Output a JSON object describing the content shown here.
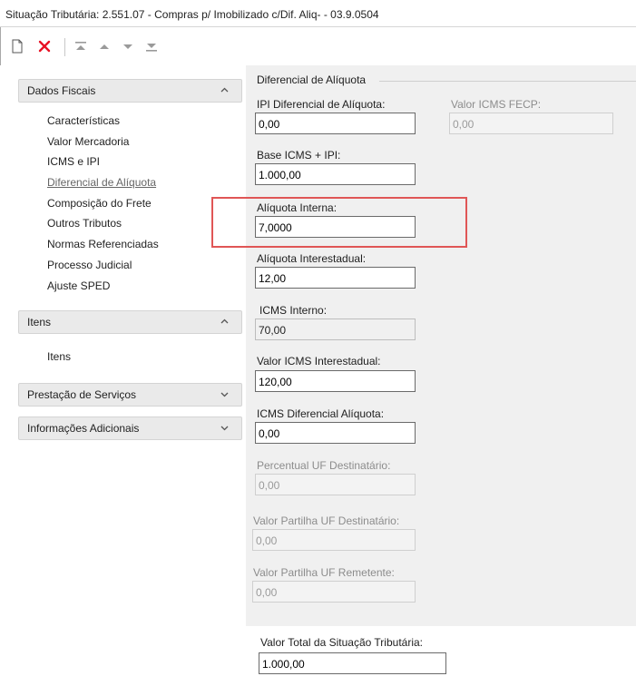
{
  "window": {
    "title": "Situação Tributária: 2.551.07 - Compras p/ Imobilizado c/Dif. Aliq-  - 03.9.0504"
  },
  "toolbar": {
    "buttons": [
      "new-icon",
      "delete-icon",
      "move-first-icon",
      "move-up-icon",
      "move-down-icon",
      "move-last-icon"
    ],
    "delete_color": "#e81123"
  },
  "sidebar": {
    "groups": [
      {
        "label": "Dados Fiscais",
        "expanded": true,
        "items": [
          "Características",
          "Valor Mercadoria",
          "ICMS e IPI",
          "Diferencial de Alíquota",
          "Composição do Frete",
          "Outros Tributos",
          "Normas Referenciadas",
          "Processo Judicial",
          "Ajuste SPED"
        ],
        "active_item": "Diferencial de Alíquota"
      },
      {
        "label": "Itens",
        "expanded": true,
        "items": [
          "Itens"
        ]
      },
      {
        "label": "Prestação de Serviços",
        "expanded": false,
        "items": []
      },
      {
        "label": "Informações Adicionais",
        "expanded": false,
        "items": []
      }
    ]
  },
  "section": {
    "title": "Diferencial de Alíquota"
  },
  "fields": {
    "ipi_diferencial": {
      "label": "IPI Diferencial de Alíquota:",
      "value": "0,00"
    },
    "valor_icms_fecp": {
      "label": "Valor ICMS FECP:",
      "value": "0,00"
    },
    "base_icms_ipi": {
      "label": "Base ICMS + IPI:",
      "value": "1.000,00"
    },
    "aliquota_interna": {
      "label": "Alíquota Interna:",
      "value": "7,0000"
    },
    "aliquota_interestadual": {
      "label": "Alíquota Interestadual:",
      "value": "12,00"
    },
    "icms_interno": {
      "label": "ICMS Interno:",
      "value": "70,00"
    },
    "valor_icms_interestadual": {
      "label": "Valor ICMS Interestadual:",
      "value": "120,00"
    },
    "icms_diferencial_aliquota": {
      "label": "ICMS Diferencial Alíquota:",
      "value": "0,00"
    },
    "percentual_uf_destinatario": {
      "label": "Percentual UF Destinatário:",
      "value": "0,00"
    },
    "valor_partilha_uf_destinatario": {
      "label": "Valor Partilha UF Destinatário:",
      "value": "0,00"
    },
    "valor_partilha_uf_remetente": {
      "label": "Valor Partilha UF Remetente:",
      "value": "0,00"
    },
    "valor_total_situacao": {
      "label": "Valor Total da Situação Tributária:",
      "value": "1.000,00"
    }
  },
  "colors": {
    "highlight_border": "#e05656",
    "group_header_bg": "#eaeaea",
    "content_bg": "#f0f0f0"
  }
}
